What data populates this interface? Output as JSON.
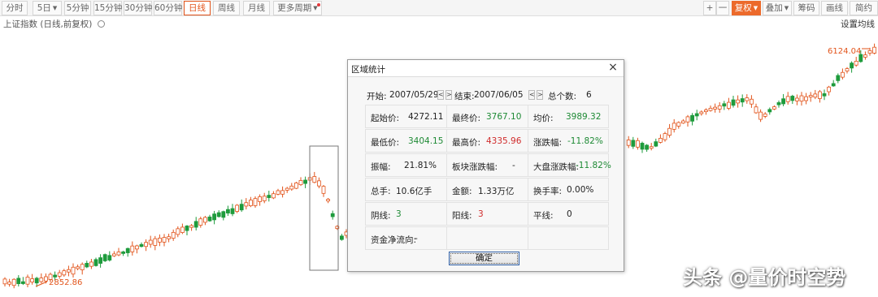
{
  "toolbar": {
    "periods": [
      {
        "label": "分时",
        "active": false,
        "caret": false
      },
      {
        "label": "5日",
        "active": false,
        "caret": true
      },
      {
        "label": "5分钟",
        "active": false,
        "caret": false
      },
      {
        "label": "15分钟",
        "active": false,
        "caret": false
      },
      {
        "label": "30分钟",
        "active": false,
        "caret": false
      },
      {
        "label": "60分钟",
        "active": false,
        "caret": false
      },
      {
        "label": "日线",
        "active": true,
        "caret": false
      },
      {
        "label": "周线",
        "active": false,
        "caret": false
      },
      {
        "label": "月线",
        "active": false,
        "caret": false
      },
      {
        "label": "更多周期",
        "active": false,
        "caret": true
      }
    ],
    "zoom_in": "+",
    "zoom_out": "一",
    "fuquan": "复权",
    "diejia": "叠加",
    "chouma": "筹码",
    "huaxian": "画线",
    "jianyue": "简约"
  },
  "subtitle": {
    "index_name": "上证指数",
    "mode": "(日线,前复权)"
  },
  "ma_settings": "设置均线",
  "chart_labels": {
    "high_label": "6124.04",
    "low_label": "2852.86"
  },
  "colors": {
    "up": "#e2541b",
    "down": "#1e9b3c",
    "accent": "#ec6a2b"
  },
  "dialog": {
    "title": "区域统计",
    "close": "×",
    "start_label": "开始:",
    "start_date": "2007/05/29",
    "end_label": "结束:",
    "end_date": "2007/06/05",
    "count_label": "总个数:",
    "count": "6",
    "prev": "<",
    "next": ">",
    "stats": [
      [
        {
          "label": "起始价:",
          "value": "4272.11",
          "color": ""
        },
        {
          "label": "最终价:",
          "value": "3767.10",
          "color": "green"
        },
        {
          "label": "均价:",
          "value": "3989.32",
          "color": "green"
        }
      ],
      [
        {
          "label": "最低价:",
          "value": "3404.15",
          "color": "green"
        },
        {
          "label": "最高价:",
          "value": "4335.96",
          "color": "red"
        },
        {
          "label": "涨跌幅:",
          "value": "-11.82%",
          "color": "green"
        }
      ],
      [
        {
          "label": "振幅:",
          "value": "21.81%",
          "color": ""
        },
        {
          "label": "板块涨跌幅:",
          "value": "-",
          "color": ""
        },
        {
          "label": "大盘涨跌幅:",
          "value": "-11.82%",
          "color": "green"
        }
      ],
      [
        {
          "label": "总手:",
          "value": "10.6亿手",
          "color": ""
        },
        {
          "label": "金额:",
          "value": "1.33万亿",
          "color": ""
        },
        {
          "label": "换手率:",
          "value": "0.00%",
          "color": ""
        }
      ],
      [
        {
          "label": "阴线:",
          "value": "3",
          "color": "green"
        },
        {
          "label": "阳线:",
          "value": "3",
          "color": "red"
        },
        {
          "label": "平线:",
          "value": "0",
          "color": ""
        }
      ],
      [
        {
          "label": "资金净流向:",
          "value": "-",
          "color": ""
        },
        {
          "label": "",
          "value": "",
          "color": ""
        },
        {
          "label": "",
          "value": "",
          "color": ""
        }
      ]
    ],
    "confirm": "确定"
  },
  "watermark": "头条 @量价时空势",
  "chart_data": {
    "type": "candlestick",
    "title": "",
    "series": [
      {
        "name": "上证指数",
        "y_range": [
          2700,
          6300
        ],
        "labeled_low": 2852.86,
        "labeled_high": 6124.04,
        "selected_range": {
          "start": "2007/05/29",
          "end": "2007/06/05",
          "open": 4272.11,
          "close": 3767.1,
          "low": 3404.15,
          "high": 4335.96
        }
      }
    ]
  }
}
